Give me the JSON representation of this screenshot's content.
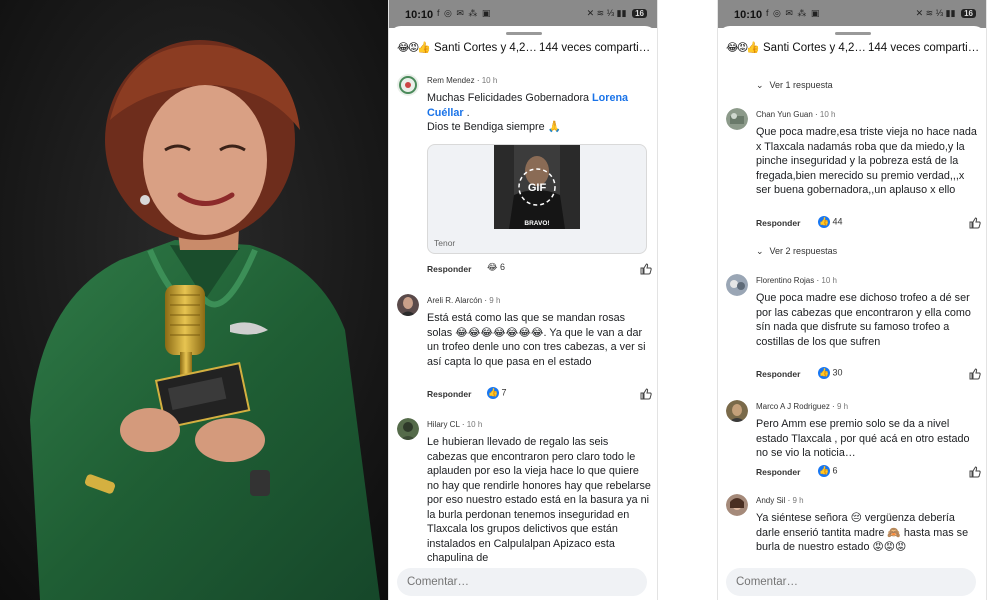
{
  "statusbar": {
    "time": "10:10",
    "left_icons": "f ◎ ✉ ⁂ ▣",
    "right_icons": "✕ ≋ ⅓ ▮▮",
    "battery": "16"
  },
  "reactions_header": {
    "emojis": "😂😡👍",
    "names": "Santi Cortes y 4,2…",
    "shares": "144 veces comparti…"
  },
  "phone1": {
    "comments": [
      {
        "author": "Rem Mendez",
        "time": "10 h",
        "text_a": "Muchas Felicidades Gobernadora ",
        "mention": "Lorena Cuéllar",
        "text_b": " .",
        "line2": "Dios te Bendiga siempre 🙏",
        "gif_label": "GIF",
        "gif_caption": "BRAVO!",
        "gif_source": "Tenor",
        "reply": "Responder",
        "reaction_emoji": "😂",
        "reaction_count": "6"
      },
      {
        "author": "Areli R. Alarcón",
        "time": "9 h",
        "text": "Está está como las que se mandan rosas solas 😂😂😂😂😂😂😂. Ya que le van a dar un trofeo denle uno con tres cabezas, a ver si así capta lo que pasa en el estado",
        "reply": "Responder",
        "reaction_count": "7"
      },
      {
        "author": "Hilary CL",
        "time": "10 h",
        "text": "Le hubieran llevado de regalo las seis cabezas que encontraron pero claro todo le aplauden por eso la vieja hace lo que quiere no hay que rendirle honores hay que rebelarse por eso nuestro estado está en la basura ya ni la burla perdonan tenemos inseguridad en Tlaxcala los grupos delictivos que están instalados en Calpulalpan Apizaco esta chapulina de"
      }
    ],
    "comment_placeholder": "Comentar…"
  },
  "phone2": {
    "view1": "Ver 1 respuesta",
    "view2": "Ver 2 respuestas",
    "comments": [
      {
        "author": "Chan Yun Guan",
        "time": "10 h",
        "text": "Que poca madre,esa triste vieja no hace nada x Tlaxcala nadamás roba que da miedo,y la pinche inseguridad y la pobreza está de la fregada,bien merecido su premio verdad,,,x ser buena gobernadora,,un aplauso x ello",
        "reply": "Responder",
        "reaction_count": "44"
      },
      {
        "author": "Florentino Rojas",
        "time": "10 h",
        "text": "Que poca madre ese dichoso trofeo a dé ser por las cabezas que encontraron y ella como sín nada que disfrute su famoso trofeo a costillas de los que sufren",
        "reply": "Responder",
        "reaction_count": "30"
      },
      {
        "author": "Marco A J Rodriguez",
        "time": "9 h",
        "text": "Pero Amm ese premio solo se da a nivel estado Tlaxcala , por qué acá en otro estado no se vio la noticia…",
        "reply": "Responder",
        "reaction_count": "6"
      },
      {
        "author": "Andy Sil",
        "time": "9 h",
        "text": "Ya siéntese señora 😔 vergüenza debería darle  enserió tantita madre 🙈 hasta mas se burla de nuestro estado 😡😡😡"
      }
    ],
    "comment_placeholder": "Comentar…"
  }
}
